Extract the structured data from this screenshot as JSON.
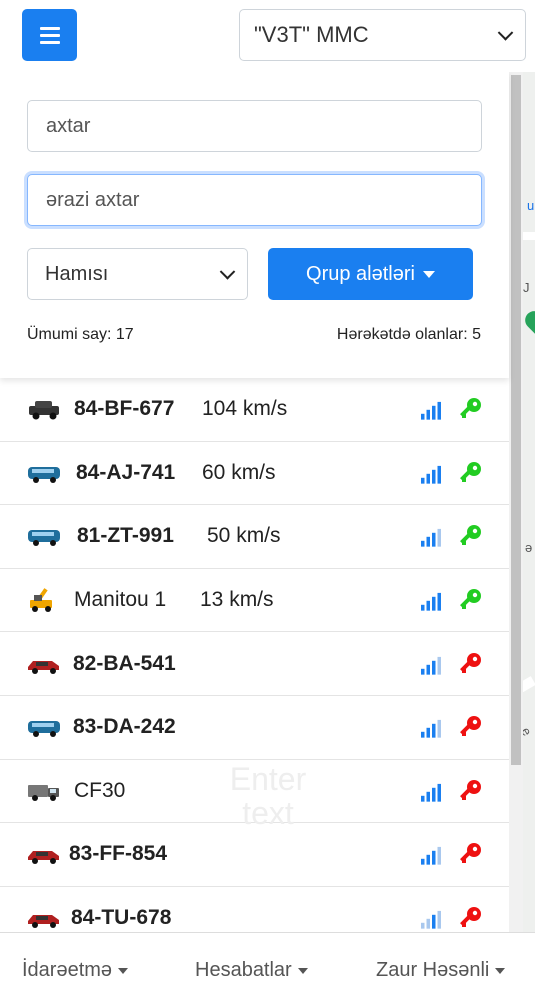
{
  "header": {
    "company_select_value": "\"V3T\" MMC"
  },
  "search": {
    "search_placeholder": "axtar",
    "area_placeholder": "ərazi axtar",
    "filter_value": "Hamısı",
    "group_tools_label": "Qrup alətləri"
  },
  "stats": {
    "total_label": "Ümumi say: 17",
    "moving_label": "Hərəkətdə olanlar: 5"
  },
  "vehicles": [
    {
      "plate": "84-BF-677",
      "speed": "104 km/s",
      "icon": "jeep-icon",
      "key_color": "#22cc22"
    },
    {
      "plate": "84-AJ-741",
      "speed": "60 km/s",
      "icon": "bus-icon",
      "key_color": "#22cc22"
    },
    {
      "plate": "81-ZT-991",
      "speed": "50 km/s",
      "icon": "bus-icon",
      "key_color": "#22cc22"
    },
    {
      "plate": "Manitou 1",
      "speed": "13 km/s",
      "icon": "crane-icon",
      "key_color": "#22cc22"
    },
    {
      "plate": "82-BA-541",
      "speed": "",
      "icon": "car-icon",
      "key_color": "#ee1111"
    },
    {
      "plate": "83-DA-242",
      "speed": "",
      "icon": "bus-icon",
      "key_color": "#ee1111"
    },
    {
      "plate": "CF30",
      "speed": "",
      "icon": "truck-icon",
      "key_color": "#ee1111"
    },
    {
      "plate": "83-FF-854",
      "speed": "",
      "icon": "car-icon",
      "key_color": "#ee1111"
    },
    {
      "plate": "84-TU-678",
      "speed": "",
      "icon": "car-icon",
      "key_color": "#ee1111"
    }
  ],
  "overlay": {
    "ghost_text": "Enter text"
  },
  "bottom_nav": {
    "management": "İdarəetmə",
    "reports": "Hesabatlar",
    "user": "Zaur Həsənli"
  },
  "colors": {
    "primary": "#1a7ff0",
    "signal_blue": "#1a7ff0",
    "key_green": "#22cc22",
    "key_red": "#ee1111"
  }
}
